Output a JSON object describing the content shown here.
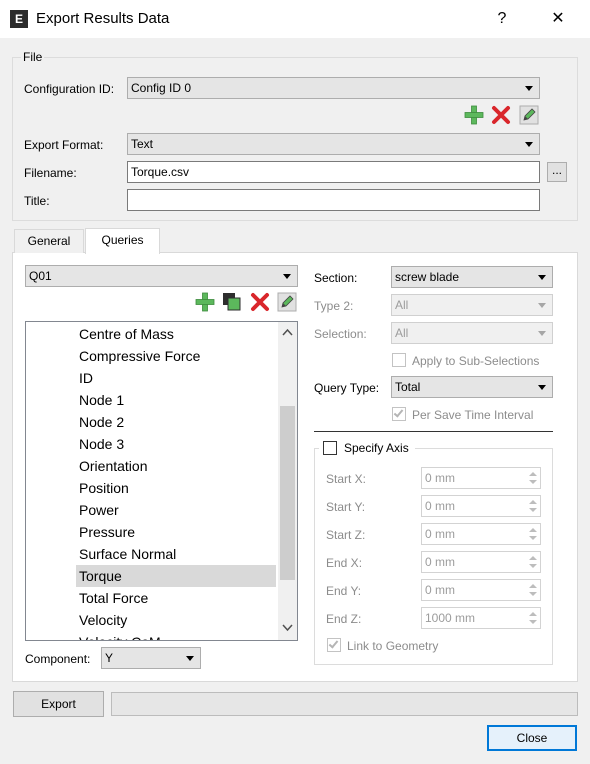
{
  "window": {
    "title": "Export Results Data",
    "help_glyph": "?",
    "close_glyph": "✕",
    "icon_letter": "E"
  },
  "file_group": {
    "label": "File",
    "configuration_id": {
      "label": "Configuration ID:",
      "value": "Config ID 0"
    },
    "export_format": {
      "label": "Export Format:",
      "value": "Text"
    },
    "filename": {
      "label": "Filename:",
      "value": "Torque.csv",
      "browse": "..."
    },
    "title": {
      "label": "Title:",
      "value": ""
    }
  },
  "tabs": [
    {
      "label": "General",
      "active": false
    },
    {
      "label": "Queries",
      "active": true
    }
  ],
  "queries": {
    "query_select": "Q01",
    "list_items": [
      "Centre of Mass",
      "Compressive Force",
      "ID",
      "Node 1",
      "Node 2",
      "Node 3",
      "Orientation",
      "Position",
      "Power",
      "Pressure",
      "Surface Normal",
      "Torque",
      "Total Force",
      "Velocity",
      "Velocity CoM"
    ],
    "selected_item": "Torque",
    "component": {
      "label": "Component:",
      "value": "Y"
    },
    "section": {
      "label": "Section:",
      "value": "screw blade"
    },
    "type2": {
      "label": "Type 2:",
      "value": "All"
    },
    "selection": {
      "label": "Selection:",
      "value": "All"
    },
    "apply_sub": {
      "label": "Apply to Sub-Selections",
      "checked": false
    },
    "query_type": {
      "label": "Query Type:",
      "value": "Total"
    },
    "per_save": {
      "label": "Per Save Time Interval",
      "checked": true
    },
    "specify_axis": {
      "label": "Specify Axis",
      "checked": false
    },
    "axis_fields": [
      {
        "label": "Start X:",
        "value": "0 mm"
      },
      {
        "label": "Start Y:",
        "value": "0 mm"
      },
      {
        "label": "Start Z:",
        "value": "0 mm"
      },
      {
        "label": "End X:",
        "value": "0 mm"
      },
      {
        "label": "End Y:",
        "value": "0 mm"
      },
      {
        "label": "End Z:",
        "value": "1000 mm"
      }
    ],
    "link_geometry": {
      "label": "Link to Geometry",
      "checked": true
    }
  },
  "footer": {
    "export_label": "Export",
    "close_label": "Close"
  },
  "icons": {
    "add": "add-icon",
    "delete": "delete-icon",
    "edit": "edit-icon",
    "copy": "copy-icon"
  }
}
